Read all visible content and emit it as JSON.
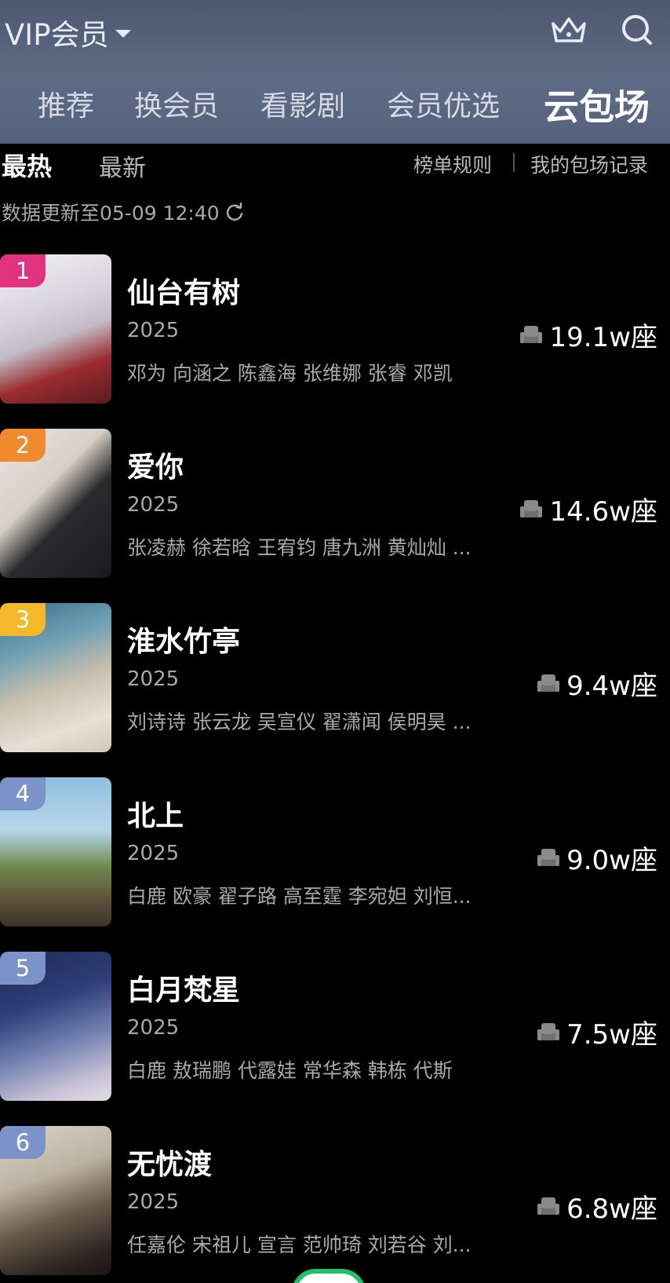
{
  "header": {
    "vip_label": "VIP会员",
    "tabs": [
      {
        "label": "推荐",
        "active": false
      },
      {
        "label": "换会员",
        "active": false
      },
      {
        "label": "看影剧",
        "active": false
      },
      {
        "label": "会员优选",
        "active": false
      },
      {
        "label": "云包场",
        "active": true
      }
    ]
  },
  "subbar": {
    "hot": "最热",
    "new": "最新",
    "rules": "榜单规则",
    "records": "我的包场记录"
  },
  "update_text": "数据更新至05-09 12:40",
  "items": [
    {
      "rank": "1",
      "rank_color": "#e0327f",
      "title": "仙台有树",
      "year": "2025",
      "cast": "邓为 向涵之 陈鑫海 张维娜 张睿 邓凯",
      "seats": "19.1w座"
    },
    {
      "rank": "2",
      "rank_color": "#f08a2c",
      "title": "爱你",
      "year": "2025",
      "cast": "张凌赫 徐若晗 王宥钧 唐九洲 黄灿灿 ...",
      "seats": "14.6w座"
    },
    {
      "rank": "3",
      "rank_color": "#f4b82a",
      "title": "淮水竹亭",
      "year": "2025",
      "cast": "刘诗诗 张云龙 吴宣仪 翟潇闻 侯明昊 ...",
      "seats": "9.4w座"
    },
    {
      "rank": "4",
      "rank_color": "#7b93c9",
      "title": "北上",
      "year": "2025",
      "cast": "白鹿 欧豪 翟子路 高至霆 李宛妲 刘恒...",
      "seats": "9.0w座"
    },
    {
      "rank": "5",
      "rank_color": "#7b93c9",
      "title": "白月梵星",
      "year": "2025",
      "cast": "白鹿 敖瑞鹏 代露娃 常华森 韩栋 代斯",
      "seats": "7.5w座"
    },
    {
      "rank": "6",
      "rank_color": "#7b93c9",
      "title": "无忧渡",
      "year": "2025",
      "cast": "任嘉伦 宋祖儿 宣言 范帅琦 刘若谷 刘...",
      "seats": "6.8w座"
    }
  ]
}
